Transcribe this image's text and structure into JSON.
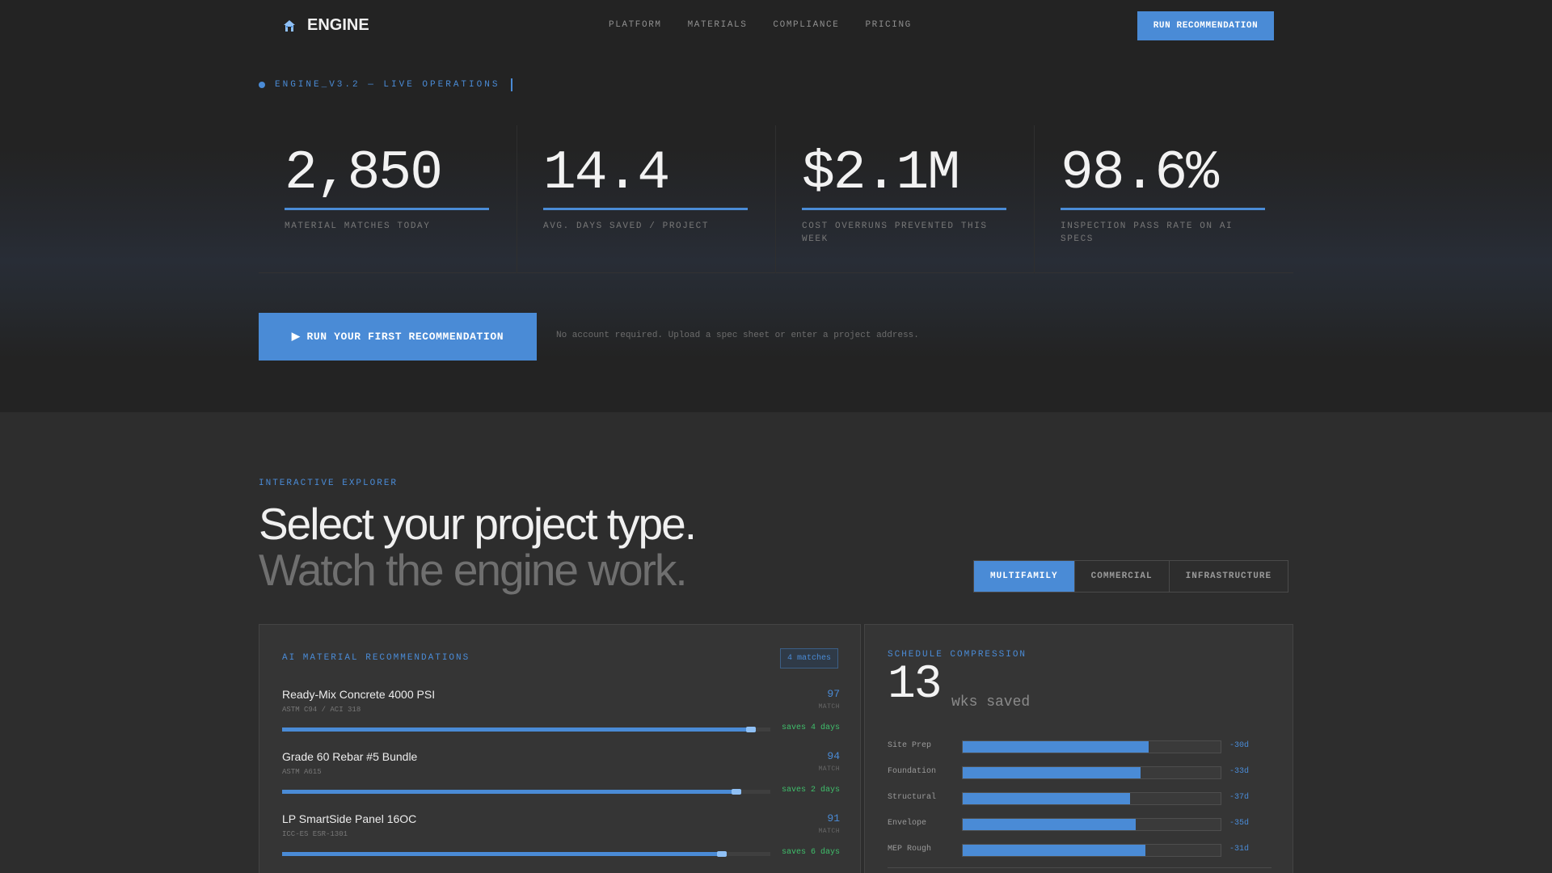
{
  "brand": {
    "name": "ENGINE",
    "icon": "house-icon"
  },
  "nav": {
    "links": [
      "PLATFORM",
      "MATERIALS",
      "COMPLIANCE",
      "PRICING"
    ],
    "cta": "RUN RECOMMENDATION"
  },
  "status": {
    "text": "ENGINE_V3.2 — LIVE OPERATIONS"
  },
  "stats": [
    {
      "value": "2,850",
      "label": "MATERIAL MATCHES TODAY"
    },
    {
      "value": "14.4",
      "label": "AVG. DAYS SAVED / PROJECT"
    },
    {
      "value": "$2.1M",
      "label": "COST OVERRUNS PREVENTED THIS WEEK"
    },
    {
      "value": "98.6%",
      "label": "INSPECTION PASS RATE ON AI SPECS"
    }
  ],
  "hero": {
    "cta": "RUN YOUR FIRST RECOMMENDATION",
    "cta_icon": "▶",
    "note": "No account required. Upload a spec sheet or enter a project address."
  },
  "explorer": {
    "eyebrow": "INTERACTIVE EXPLORER",
    "headline": "Select your project type.",
    "subheadline": "Watch the engine work.",
    "tabs": [
      {
        "label": "MULTIFAMILY",
        "active": true
      },
      {
        "label": "COMMERCIAL",
        "active": false
      },
      {
        "label": "INFRASTRUCTURE",
        "active": false
      }
    ]
  },
  "recommendations": {
    "title": "AI MATERIAL RECOMMENDATIONS",
    "badge": "4 matches",
    "items": [
      {
        "name": "Ready-Mix Concrete 4000 PSI",
        "spec": "ASTM C94 / ACI 318",
        "score": "97",
        "score_label": "MATCH",
        "match_fraction": 0.97,
        "savings": "saves 4 days"
      },
      {
        "name": "Grade 60 Rebar #5 Bundle",
        "spec": "ASTM A615",
        "score": "94",
        "score_label": "MATCH",
        "match_fraction": 0.94,
        "savings": "saves 2 days"
      },
      {
        "name": "LP SmartSide Panel 16OC",
        "spec": "ICC-ES ESR-1301",
        "score": "91",
        "score_label": "MATCH",
        "match_fraction": 0.91,
        "savings": "saves 6 days"
      }
    ]
  },
  "schedule": {
    "title": "SCHEDULE COMPRESSION",
    "value": "13",
    "unit": "wks saved",
    "phases": [
      {
        "label": "Site Prep",
        "fill_fraction": 0.72,
        "delta": "-30d"
      },
      {
        "label": "Foundation",
        "fill_fraction": 0.69,
        "delta": "-33d"
      },
      {
        "label": "Structural",
        "fill_fraction": 0.65,
        "delta": "-37d"
      },
      {
        "label": "Envelope",
        "fill_fraction": 0.67,
        "delta": "-35d"
      },
      {
        "label": "MEP Rough",
        "fill_fraction": 0.71,
        "delta": "-31d"
      }
    ]
  },
  "colors": {
    "accent": "#4a8bd6",
    "success": "#3fbf6b",
    "background": "#232323",
    "section": "#2d2d2d",
    "panel": "#353535"
  }
}
